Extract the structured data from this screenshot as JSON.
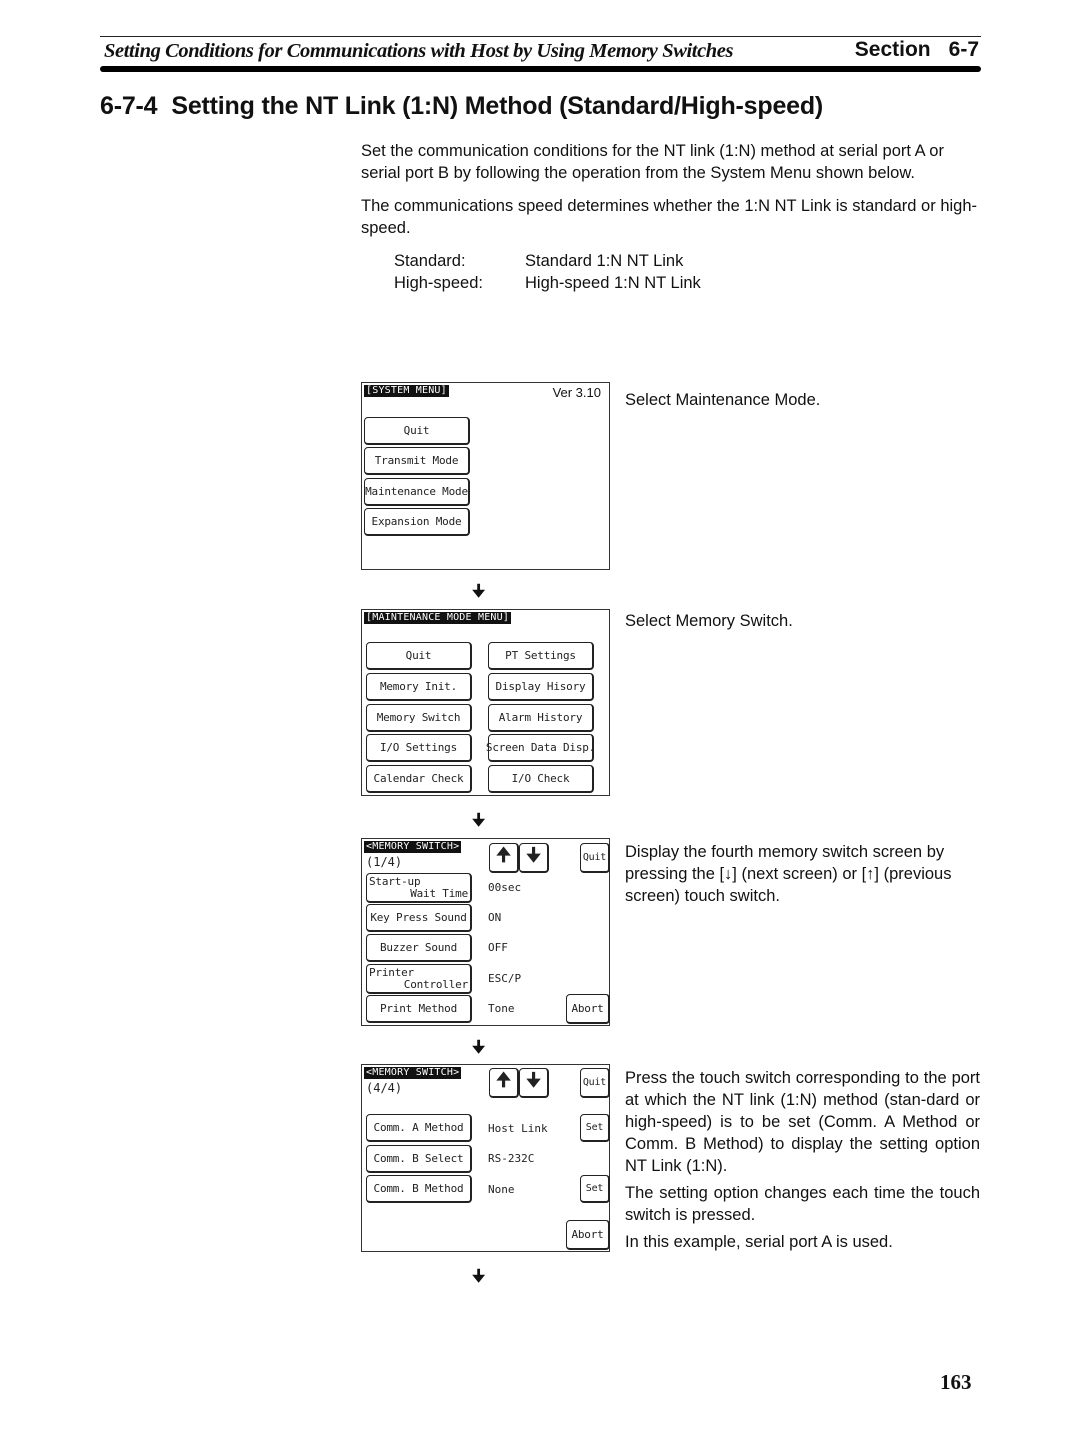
{
  "running_header": {
    "title": "Setting Conditions for Communications with Host by Using Memory Switches",
    "section_label": "Section",
    "section_number": "6-7"
  },
  "heading": {
    "number": "6-7-4",
    "title": "Setting the NT Link (1:N) Method (Standard/High-speed)"
  },
  "intro": {
    "p1": "Set the communication conditions for the NT link (1:N) method at serial port A or serial port B by following the operation from the System Menu shown below.",
    "p2": "The communications speed determines whether the 1:N NT Link is standard or high-speed.",
    "definitions": [
      {
        "term": "Standard:",
        "desc": "Standard 1:N NT Link"
      },
      {
        "term": "High-speed:",
        "desc": "High-speed 1:N NT Link"
      }
    ]
  },
  "steps": [
    {
      "screen": {
        "title": "[SYSTEM MENU]",
        "version": "Ver 3.10",
        "buttons": [
          "Quit",
          "Transmit Mode",
          "Maintenance Mode",
          "Expansion Mode"
        ]
      },
      "caption": "Select Maintenance Mode."
    },
    {
      "screen": {
        "title": "[MAINTENANCE MODE MENU]",
        "left_buttons": [
          "Quit",
          "Memory Init.",
          "Memory Switch",
          "I/O Settings",
          "Calendar Check"
        ],
        "right_buttons": [
          "PT Settings",
          "Display Hisory",
          "Alarm History",
          "Screen Data Disp.",
          "I/O Check"
        ]
      },
      "caption": "Select Memory Switch."
    },
    {
      "screen": {
        "title": "<MEMORY SWITCH>",
        "page": "(1/4)",
        "up_arrow": "🠉",
        "down_arrow": "🠋",
        "quit": "Quit",
        "abort": "Abort",
        "rows": [
          {
            "label_1": "Start-up",
            "label_2": "Wait Time",
            "value": "00sec"
          },
          {
            "label": "Key Press Sound",
            "value": "ON"
          },
          {
            "label": "Buzzer Sound",
            "value": "OFF"
          },
          {
            "label_1": "Printer",
            "label_2": "Controller",
            "value": "ESC/P"
          },
          {
            "label": "Print Method",
            "value": "Tone"
          }
        ]
      },
      "caption": "Display the fourth memory switch screen by pressing the [↓] (next screen) or [↑] (previous screen) touch switch."
    },
    {
      "screen": {
        "title": "<MEMORY SWITCH>",
        "page": "(4/4)",
        "up_arrow": "🠉",
        "down_arrow": "🠋",
        "quit": "Quit",
        "abort": "Abort",
        "set": "Set",
        "rows": [
          {
            "label": "Comm. A Method",
            "value": "Host Link"
          },
          {
            "label": "Comm. B Select",
            "value": "RS-232C"
          },
          {
            "label": "Comm. B Method",
            "value": "None"
          }
        ]
      },
      "caption_1": "Press the touch switch corresponding to the port at which the NT link (1:N) method (stan-dard or high-speed) is to be set (Comm. A Method or Comm. B Method) to display the setting option NT Link (1:N).",
      "caption_2": "The setting option changes each time the touch switch is pressed.",
      "caption_3": "In this example, serial port A is used."
    }
  ],
  "flow_arrow": "🠋",
  "page_number": "163"
}
